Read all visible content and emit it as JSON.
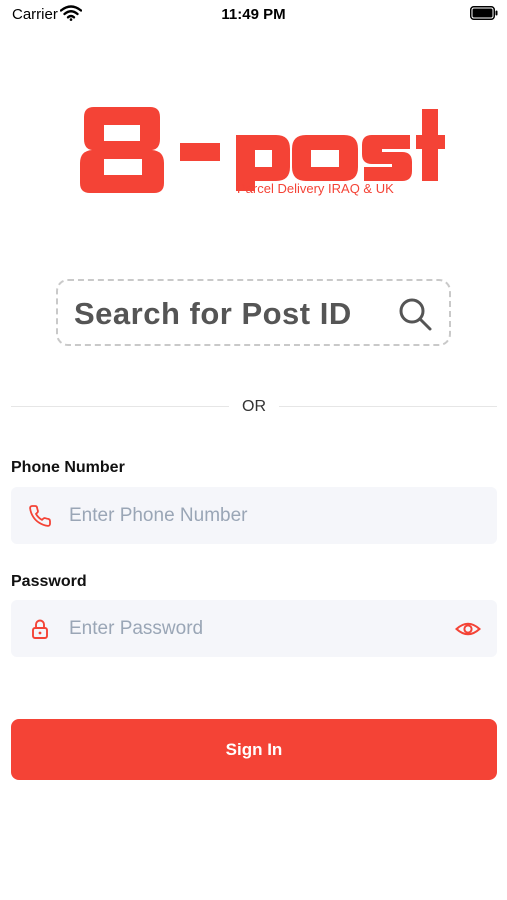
{
  "status_bar": {
    "carrier": "Carrier",
    "time": "11:49 PM"
  },
  "logo": {
    "wordmark": "B-post",
    "tagline": "Parcel Delivery IRAQ & UK"
  },
  "search": {
    "label": "Search for Post ID"
  },
  "divider": {
    "text": "OR"
  },
  "phone": {
    "label": "Phone Number",
    "placeholder": "Enter Phone Number",
    "value": ""
  },
  "password": {
    "label": "Password",
    "placeholder": "Enter Password",
    "value": ""
  },
  "signin": {
    "label": "Sign In"
  },
  "colors": {
    "brand": "#f44336",
    "field_bg": "#f5f6fa",
    "placeholder": "#9aa6b6"
  },
  "icons": {
    "phone": "phone-icon",
    "password": "lock-icon",
    "visibility": "eye-icon",
    "search": "search-icon"
  }
}
